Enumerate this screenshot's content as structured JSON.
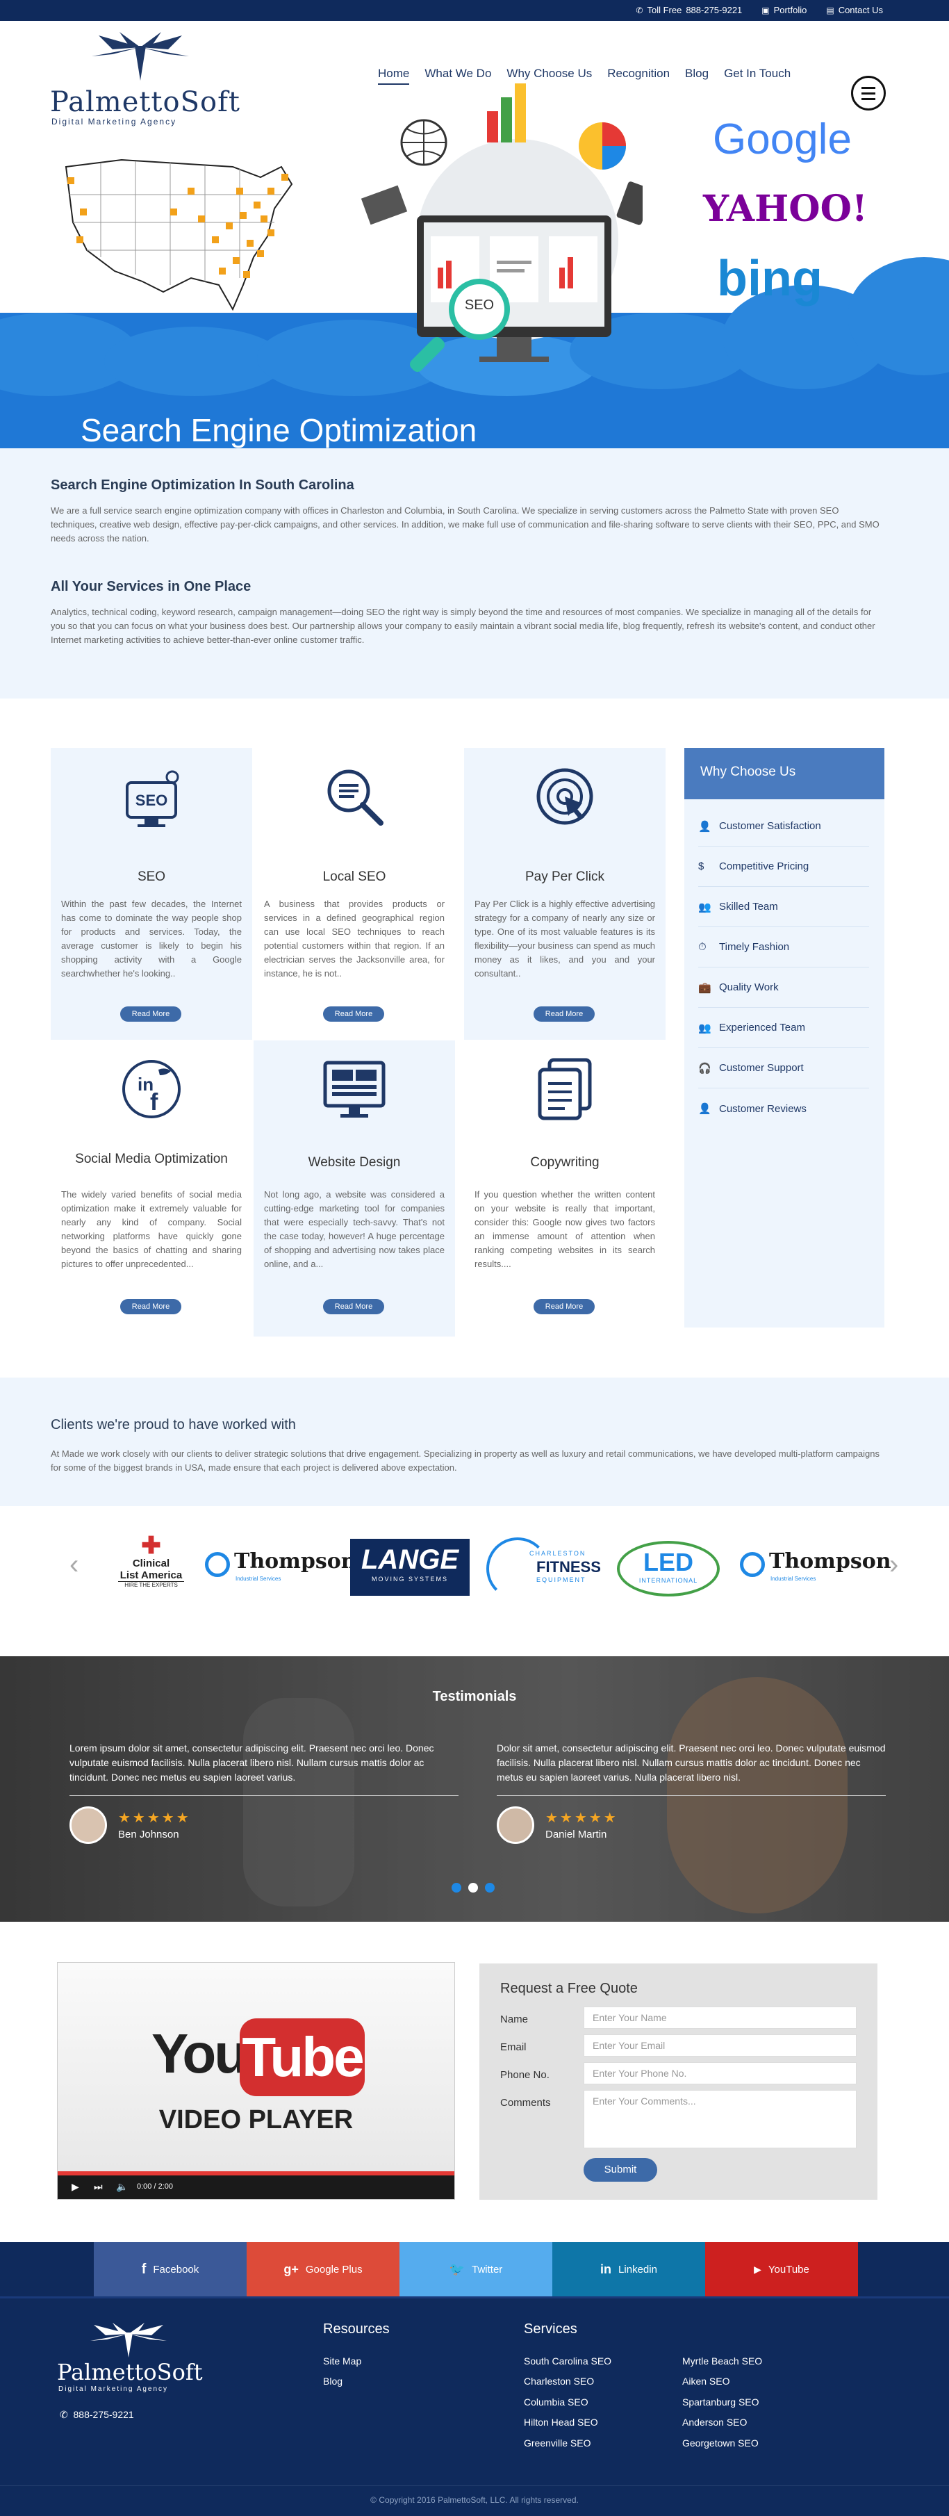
{
  "topbar": {
    "toll_free_label": "Toll Free",
    "phone": "888-275-9221",
    "portfolio": "Portfolio",
    "contact": "Contact Us"
  },
  "logo": {
    "name": "PalmettoSoft",
    "tagline": "Digital Marketing Agency"
  },
  "nav": {
    "items": [
      "Home",
      "What We Do",
      "Why Choose Us",
      "Recognition",
      "Blog",
      "Get In Touch"
    ]
  },
  "hero": {
    "title": "Search Engine Optimization",
    "seo_badge": "SEO",
    "engines": [
      "Google",
      "YAHOO!",
      "bing"
    ]
  },
  "intro": {
    "heading1": "Search Engine Optimization In South Carolina",
    "para1": "We are a full service search engine optimization company with offices in Charleston and Columbia, in South Carolina. We specialize in serving customers across the Palmetto State with proven SEO techniques, creative web design, effective pay-per-click campaigns, and other services. In addition, we make full use of communication and file-sharing software to serve clients with their SEO, PPC, and SMO needs across the nation.",
    "heading2": "All Your Services in One Place",
    "para2": "Analytics, technical coding, keyword research, campaign management—doing SEO the right way is simply beyond the time and resources of most companies. We specialize in managing all of the details for you so that you can focus on what your business does best. Our partnership allows your company to easily maintain a vibrant social media life, blog frequently, refresh its website's content, and conduct other Internet marketing activities to achieve better-than-ever online customer traffic."
  },
  "services": [
    {
      "title": "SEO",
      "icon": "seo-monitor-icon",
      "text": "Within the past few decades, the Internet has come to dominate the way people shop for products and services. Today, the average customer is likely to begin his shopping activity with a Google searchwhether he's looking..",
      "button": "Read More"
    },
    {
      "title": "Local SEO",
      "icon": "magnifier-icon",
      "text": "A business that provides products or services in a defined geographical region can use local SEO techniques to reach potential customers within that region. If an electrician serves the Jacksonville area, for instance, he is not..",
      "button": "Read More"
    },
    {
      "title": "Pay Per Click",
      "icon": "click-target-icon",
      "text": "Pay Per Click is a highly effective advertising strategy for a company of nearly any size or type. One of its most valuable features is its flexibility—your business can spend as much money as it likes, and you and your consultant..",
      "button": "Read More"
    },
    {
      "title": "Social Media Optimization",
      "icon": "social-media-icon",
      "text": "The widely varied benefits of social media optimization make it extremely valuable for nearly any kind of company. Social networking platforms have quickly gone beyond the basics of chatting and sharing pictures to offer unprecedented...",
      "button": "Read More"
    },
    {
      "title": "Website Design",
      "icon": "website-layout-icon",
      "text": "Not long ago, a website was considered a cutting-edge marketing tool for companies that were especially tech-savvy. That's not the case today, however! A huge percentage of shopping and advertising now takes place online, and a...",
      "button": "Read More"
    },
    {
      "title": "Copywriting",
      "icon": "documents-icon",
      "text": "If you question whether the written content on your website is really that important, consider this: Google now gives two factors an immense amount of attention when ranking competing websites in its search results....",
      "button": "Read More"
    }
  ],
  "why": {
    "title": "Why Choose Us",
    "items": [
      {
        "label": "Customer Satisfaction",
        "icon": "user-check-icon"
      },
      {
        "label": "Competitive Pricing",
        "icon": "dollar-icon"
      },
      {
        "label": "Skilled Team",
        "icon": "team-icon"
      },
      {
        "label": "Timely Fashion",
        "icon": "clock-person-icon"
      },
      {
        "label": "Quality Work",
        "icon": "briefcase-icon"
      },
      {
        "label": "Experienced Team",
        "icon": "group-icon"
      },
      {
        "label": "Customer Support",
        "icon": "headset-icon"
      },
      {
        "label": "Customer Reviews",
        "icon": "review-icon"
      }
    ]
  },
  "clients": {
    "heading": "Clients we're proud to have worked with",
    "text": "At Made we work closely with our clients to deliver strategic solutions that drive engagement. Specializing in property as well as luxury and retail communications, we have developed multi-platform campaigns for some of the biggest brands in USA, made ensure that each project is delivered above expectation.",
    "logos": [
      {
        "line1": "Clinical",
        "line2": "List America",
        "line3": "HIRE THE EXPERTS"
      },
      {
        "line1": "Thompson",
        "line2": "Industrial Services"
      },
      {
        "line1": "LANGE",
        "line2": "MOVING SYSTEMS"
      },
      {
        "line1": "CHARLESTON",
        "line2": "FITNESS",
        "line3": "EQUIPMENT"
      },
      {
        "line1": "LED",
        "line2": "INTERNATIONAL"
      },
      {
        "line1": "Thompson",
        "line2": "Industrial Services"
      }
    ]
  },
  "testimonials": {
    "title": "Testimonials",
    "items": [
      {
        "text": "Lorem ipsum dolor sit amet, consectetur adipiscing elit. Praesent nec orci leo. Donec vulputate euismod facilisis. Nulla placerat libero nisl. Nullam cursus mattis dolor ac tincidunt. Donec nec metus eu sapien laoreet varius.",
        "name": "Ben Johnson",
        "stars": 5
      },
      {
        "text": "Dolor sit amet, consectetur adipiscing elit. Praesent nec orci leo. Donec vulputate euismod facilisis. Nulla placerat libero nisl. Nullam cursus mattis dolor ac tincidunt. Donec nec metus eu sapien laoreet varius. Nulla placerat libero nisl.",
        "name": "Daniel Martin",
        "stars": 5
      }
    ],
    "active_dot": 2
  },
  "video": {
    "line1": "You",
    "line2": "Tube",
    "caption": "VIDEO PLAYER",
    "time": "0:00 / 2:00"
  },
  "quote_form": {
    "title": "Request a Free Quote",
    "fields": [
      {
        "label": "Name",
        "placeholder": "Enter Your Name"
      },
      {
        "label": "Email",
        "placeholder": "Enter Your Email"
      },
      {
        "label": "Phone No.",
        "placeholder": "Enter Your Phone No."
      },
      {
        "label": "Comments",
        "placeholder": "Enter Your Comments..."
      }
    ],
    "submit": "Submit"
  },
  "social": [
    {
      "label": "Facebook",
      "icon": "facebook-icon",
      "glyph": "f",
      "color": "#3b5998"
    },
    {
      "label": "Google Plus",
      "icon": "google-plus-icon",
      "glyph": "g+",
      "color": "#dd4b39"
    },
    {
      "label": "Twitter",
      "icon": "twitter-icon",
      "glyph": "🐦",
      "color": "#55acee"
    },
    {
      "label": "Linkedin",
      "icon": "linkedin-icon",
      "glyph": "in",
      "color": "#0e76a8"
    },
    {
      "label": "YouTube",
      "icon": "youtube-icon",
      "glyph": "▶",
      "color": "#cd201f"
    }
  ],
  "footer": {
    "phone": "888-275-9221",
    "resources_title": "Resources",
    "resources": [
      "Site Map",
      "Blog"
    ],
    "services_title": "Services",
    "services_col1": [
      "South Carolina SEO",
      "Charleston SEO",
      "Columbia SEO",
      "Hilton Head SEO",
      "Greenville SEO"
    ],
    "services_col2": [
      "Myrtle Beach SEO",
      "Aiken SEO",
      "Spartanburg SEO",
      "Anderson SEO",
      "Georgetown SEO"
    ],
    "copyright": "© Copyright 2016 PalmettoSoft, LLC. All rights reserved."
  }
}
